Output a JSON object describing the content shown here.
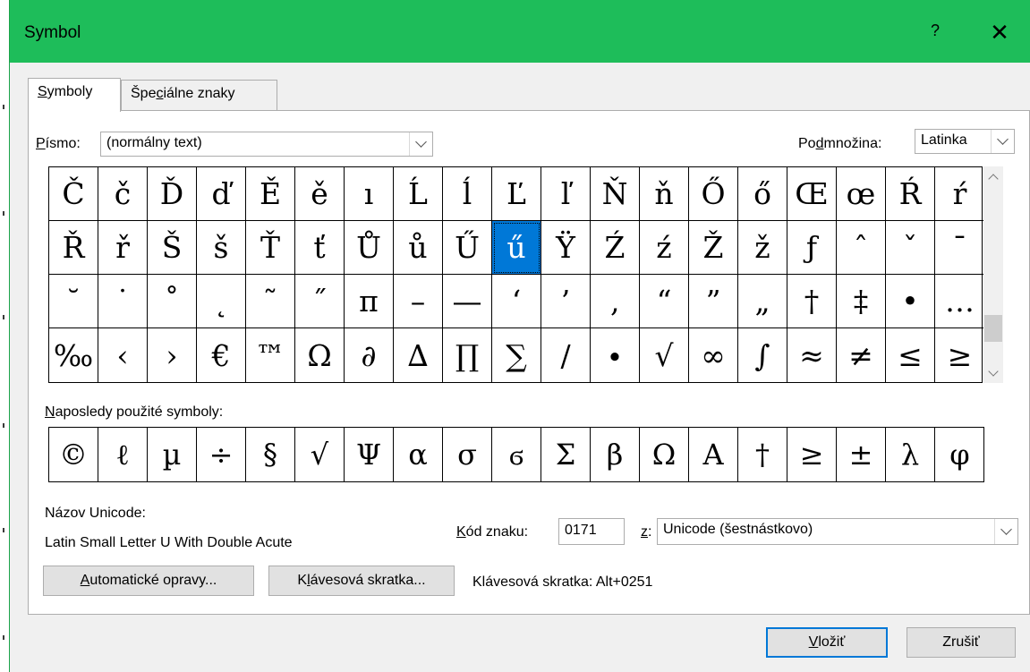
{
  "dialog": {
    "title": "Symbol",
    "help": "?",
    "close": "✕"
  },
  "tabs": [
    {
      "pre": "",
      "u": "S",
      "post": "ymboly"
    },
    {
      "pre": "Špe",
      "u": "c",
      "post": "iálne znaky"
    }
  ],
  "font": {
    "label_u": "P",
    "label_rest": "ísmo:",
    "value": "(normálny text)"
  },
  "subset": {
    "label_pre": "Po",
    "label_u": "d",
    "label_post": "množina:",
    "value": "Latinka"
  },
  "symbols": [
    "Č",
    "č",
    "Ď",
    "ď",
    "Ě",
    "ě",
    "ı",
    "Ĺ",
    "ĺ",
    "Ľ",
    "ľ",
    "Ň",
    "ň",
    "Ő",
    "ő",
    "Œ",
    "œ",
    "Ŕ",
    "ŕ",
    "Ř",
    "ř",
    "Š",
    "š",
    "Ť",
    "ť",
    "Ů",
    "ů",
    "Ű",
    "ű",
    "Ÿ",
    "Ź",
    "ź",
    "Ž",
    "ž",
    "ƒ",
    "ˆ",
    "ˇ",
    "ˉ",
    "˘",
    "˙",
    "˚",
    "˛",
    "˜",
    "˝",
    "π",
    "–",
    "—",
    "‘",
    "’",
    "‚",
    "“",
    "”",
    "„",
    "†",
    "‡",
    "•",
    "…",
    "‰",
    "‹",
    "›",
    "€",
    "™",
    "Ω",
    "∂",
    "∆",
    "∏",
    "∑",
    "∕",
    "∙",
    "√",
    "∞",
    "∫",
    "≈",
    "≠",
    "≤",
    "≥"
  ],
  "selected_symbol": "ű",
  "recent": {
    "label_u": "N",
    "label_rest": "aposledy použité symboly:",
    "items": [
      "©",
      "ℓ",
      "µ",
      "÷",
      "§",
      "√",
      "Ψ",
      "α",
      "σ",
      "ϭ",
      "Σ",
      "β",
      "Ω",
      "A",
      "†",
      "≥",
      "±",
      "λ",
      "φ"
    ]
  },
  "unicode": {
    "name_label": "Názov Unicode:",
    "name_value": "Latin Small Letter U With Double Acute"
  },
  "charcode": {
    "label_u": "K",
    "label_rest": "ód znaku:",
    "value": "0171",
    "from_label_u": "z",
    "from_label_rest": ":",
    "from_value": "Unicode (šestnástkovo)"
  },
  "buttons": {
    "autocorrect_u": "A",
    "autocorrect_rest": "utomatické opravy...",
    "shortcut_pre": "K",
    "shortcut_u": "l",
    "shortcut_post": "ávesová skratka...",
    "shortcut_text": "Klávesová skratka: Alt+0251",
    "insert_u": "V",
    "insert_rest": "ložiť",
    "cancel": "Zrušiť"
  },
  "colors": {
    "titlebar": "#1ebd5a",
    "selection": "#0078d7"
  }
}
